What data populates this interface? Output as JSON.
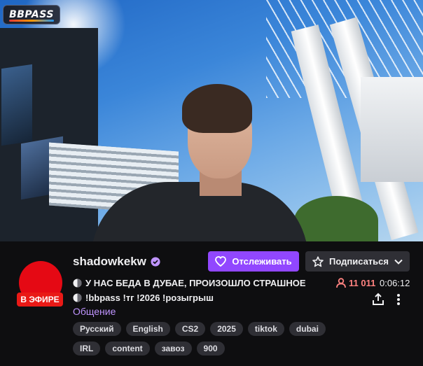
{
  "overlay": {
    "logo_text": "BBPASS"
  },
  "channel": {
    "name": "shadowkekw",
    "live_badge": "В ЭФИРЕ"
  },
  "actions": {
    "follow_label": "Отслеживать",
    "subscribe_label": "Подписаться"
  },
  "stream": {
    "title_line_1": "У НАС БЕДА В ДУБАЕ, ПРОИЗОШЛО СТРАШНОЕ",
    "title_line_2": "!bbpass !тг !2026 !розыгрыш",
    "category": "Общение",
    "viewers": "11 011",
    "uptime": "0:06:12"
  },
  "tags": [
    "Русский",
    "English",
    "CS2",
    "2025",
    "tiktok",
    "dubai",
    "IRL",
    "content",
    "завоз",
    "900"
  ],
  "colors": {
    "accent": "#9147ff",
    "live": "#e91916",
    "viewers": "#ff8280",
    "category": "#bf94ff"
  },
  "icons": [
    "verified-icon",
    "heart-icon",
    "star-icon",
    "chevron-down-icon",
    "disc-icon",
    "person-icon",
    "share-icon",
    "more-icon"
  ]
}
